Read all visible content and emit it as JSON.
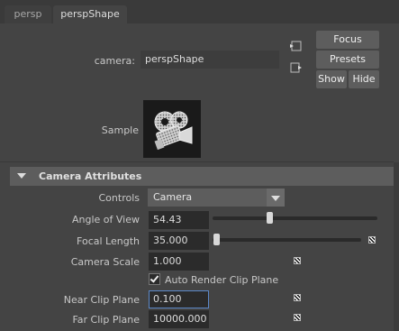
{
  "tabs": [
    {
      "label": "persp"
    },
    {
      "label": "perspShape"
    }
  ],
  "camera": {
    "label": "camera:",
    "value": "perspShape"
  },
  "buttons": {
    "focus": "Focus",
    "presets": "Presets",
    "show": "Show",
    "hide": "Hide"
  },
  "sample": {
    "label": "Sample"
  },
  "section": {
    "title": "Camera Attributes"
  },
  "controls": {
    "label": "Controls",
    "value": "Camera"
  },
  "attributes": {
    "angle_of_view": {
      "label": "Angle of View",
      "value": "54.43"
    },
    "focal_length": {
      "label": "Focal Length",
      "value": "35.000"
    },
    "camera_scale": {
      "label": "Camera Scale",
      "value": "1.000"
    },
    "auto_render_clip": {
      "label": "Auto Render Clip Plane",
      "checked": true
    },
    "near_clip": {
      "label": "Near Clip Plane",
      "value": "0.100"
    },
    "far_clip": {
      "label": "Far Clip Plane",
      "value": "10000.000"
    }
  },
  "sliders": {
    "angle_of_view_level": 0.34,
    "focal_length_level": 0.0
  },
  "colors": {
    "background": "#444444",
    "field": "#2b2b2b",
    "button": "#5d5d5d",
    "focus_outline": "#5b88c8"
  }
}
